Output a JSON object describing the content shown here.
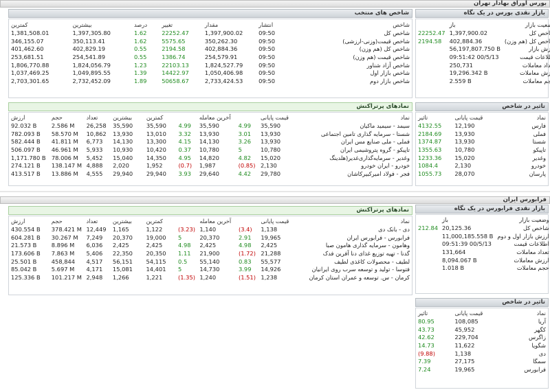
{
  "top_bar": {
    "title": "بورس اوراق بهادار تهران"
  },
  "tse_overview": {
    "title": "بازار نقدی بورس در یک نگاه",
    "rows": [
      {
        "label": "وضعیت بازار",
        "value": "باز",
        "change": ""
      },
      {
        "label": "شاخص کل",
        "value": "1,397,900.02",
        "change": "22252.47"
      },
      {
        "label": "شاخص کل (هم وزن)",
        "value": "402,884.36",
        "change": "2194.58"
      },
      {
        "label": "ارزش بازار",
        "value": "56,197,807.750 B",
        "change": ""
      },
      {
        "label": "اطلاعات قیمت",
        "value": "09:51:42 00/5/13",
        "change": ""
      },
      {
        "label": "تعداد معاملات",
        "value": "250,731",
        "change": ""
      },
      {
        "label": "ارزش معاملات",
        "value": "19,296.342 B",
        "change": ""
      },
      {
        "label": "حجم معاملات",
        "value": "2.559 B",
        "change": ""
      }
    ]
  },
  "selected_indices": {
    "title": "شاخص های منتخب",
    "columns": [
      "شاخص",
      "انتشار",
      "مقدار",
      "تغییر",
      "درصد",
      "بیشترین",
      "کمترین"
    ],
    "rows": [
      [
        "شاخص کل",
        "09:50",
        "1,397,900.02",
        "22252.47",
        "1.62",
        "1,397,305.80",
        "1,381,508.01"
      ],
      [
        "شاخص قیمت(وزنی-ارزشی)",
        "09:50",
        "350,262.30",
        "5575.65",
        "1.62",
        "350,113.41",
        "346,155.07"
      ],
      [
        "شاخص کل (هم وزن)",
        "09:50",
        "402,884.36",
        "2194.58",
        "0.55",
        "402,829.19",
        "401,462.60"
      ],
      [
        "شاخص قیمت (هم وزن)",
        "09:50",
        "254,579.91",
        "1386.74",
        "0.55",
        "254,541.89",
        "253,681.51"
      ],
      [
        "شاخص آزاد شناور",
        "09:50",
        "1,824,527.79",
        "22103.13",
        "1.23",
        "1,824,056.79",
        "1,806,770.88"
      ],
      [
        "شاخص بازار اول",
        "09:50",
        "1,050,406.98",
        "14422.97",
        "1.39",
        "1,049,895.55",
        "1,037,469.25"
      ],
      [
        "شاخص بازار دوم",
        "09:50",
        "2,733,424.53",
        "50658.67",
        "1.89",
        "2,732,452.09",
        "2,703,301.65"
      ]
    ]
  },
  "tse_influence": {
    "title": "تاثیر در شاخص",
    "columns": [
      "نماد",
      "قیمت پایانی",
      "تاثیر"
    ],
    "rows": [
      [
        "فارس",
        "12,190",
        "4132.55"
      ],
      [
        "فملی",
        "13,930",
        "2184.69"
      ],
      [
        "شستا",
        "13,930",
        "1374.87"
      ],
      [
        "تاپیکو",
        "10,780",
        "1355.63"
      ],
      [
        "وغدیر",
        "15,020",
        "1233.36"
      ],
      [
        "خودرو",
        "2,130",
        "1084.4"
      ],
      [
        "پارسان",
        "28,070",
        "1055.73"
      ]
    ]
  },
  "tse_top_symbols": {
    "title": "نمادهای پرتراکنش",
    "columns": [
      "نماد",
      "قیمت پایانی",
      "",
      "آخرین معامله",
      "",
      "کمترین",
      "بیشترین",
      "تعداد",
      "حجم",
      "ارزش"
    ],
    "rows": [
      [
        "سیمد - سیمید ماکیان",
        "35,590",
        "4.99",
        "35,590",
        "4.99",
        "35,590",
        "35,590",
        "26,258",
        "2.586 M",
        "92.032 B"
      ],
      [
        "شستا - سرمایه گذاری تامین اجتماعی",
        "13,930",
        "3.01",
        "13,930",
        "3.32",
        "13,010",
        "13,930",
        "10,862",
        "58.570 M",
        "782.093 B"
      ],
      [
        "فملی - ملی صنایع مس ایران",
        "13,930",
        "3.26",
        "14,130",
        "4.15",
        "13,300",
        "14,130",
        "6,773",
        "41.811 M",
        "582.444 B"
      ],
      [
        "تاپیکو - گروه پتروشیمی ایران",
        "10,780",
        "5",
        "10,780",
        "0.37",
        "10,420",
        "10,930",
        "5,933",
        "46.961 M",
        "506.097 B"
      ],
      [
        "وغدیر - سرمایه‌گذاری‌غدیر(هلدینگ",
        "15,020",
        "4.82",
        "14,820",
        "4.95",
        "14,350",
        "15,040",
        "5,452",
        "78.006 M",
        "1,171.780 B"
      ],
      [
        "خودرو - ایران خودرو",
        "2,130",
        "(0.85)",
        "1,987",
        "(0.7)",
        "1,952",
        "2,020",
        "4,888",
        "138.147 M",
        "274.121 B"
      ],
      [
        "فجر - فولاد امیرکبیرکاشان",
        "29,780",
        "4.42",
        "29,640",
        "3.93",
        "29,940",
        "29,940",
        "4,555",
        "13.886 M",
        "413.517 B"
      ]
    ]
  },
  "ifb_bar": {
    "title": "فرابورس ایران"
  },
  "ifb_overview": {
    "title": "بازار نقدی فرابورس در یک نگاه",
    "rows": [
      {
        "label": "وضعیت بازار",
        "value": "باز",
        "change": ""
      },
      {
        "label": "شاخص کل",
        "value": "20,125.36",
        "change": "212.84"
      },
      {
        "label": "ارزش بازار اول و دوم",
        "value": "11,000,185.558 B",
        "change": ""
      },
      {
        "label": "اطلاعات قیمت",
        "value": "09:51:39 00/5/13",
        "change": ""
      },
      {
        "label": "تعداد معاملات",
        "value": "131,664",
        "change": ""
      },
      {
        "label": "ارزش معاملات",
        "value": "8,094.067 B",
        "change": ""
      },
      {
        "label": "حجم معاملات",
        "value": "1.018 B",
        "change": ""
      }
    ]
  },
  "ifb_top_symbols": {
    "title": "نمادهای پرتراکنش",
    "columns": [
      "نماد",
      "قیمت پایانی",
      "",
      "آخرین معامله",
      "",
      "کمترین",
      "بیشترین",
      "تعداد",
      "حجم",
      "ارزش"
    ],
    "rows": [
      [
        "دی - بانک دی",
        "1,138",
        "(3.4)",
        "1,140",
        "(3.23)",
        "1,122",
        "1,165",
        "12,449",
        "378.421 M",
        "430.554 B"
      ],
      [
        "فرابورس - فرابورس ایران",
        "19,965",
        "2.91",
        "20,370",
        "5",
        "19,000",
        "20,370",
        "7,249",
        "30.267 M",
        "604.281 B"
      ],
      [
        "وهامون - سرمایه گذاری هامون صبا",
        "2,425",
        "4.98",
        "2,425",
        "4.98",
        "2,425",
        "2,425",
        "6,036",
        "8.896 M",
        "21.573 B"
      ],
      [
        "گدنا - تهیه توزیع غذای دنا آفرین فدک",
        "21,288",
        "(1.72)",
        "21,900",
        "1.11",
        "20,350",
        "22,350",
        "5,406",
        "7.863 M",
        "173.606 B"
      ],
      [
        "لطیف - محصولات کاغذی لطیف",
        "55,577",
        "0.83",
        "55,140",
        "0.5",
        "54,115",
        "56,151",
        "4,517",
        "458,844",
        "25.501 B"
      ],
      [
        "فتوسا - تولید و توسعه سرب روی ایرانیان",
        "14,926",
        "3.99",
        "14,730",
        "5",
        "14,401",
        "15,081",
        "4,171",
        "5.697 M",
        "85.042 B"
      ],
      [
        "کرمان - س. توسعه و عمران استان کرمان",
        "1,238",
        "(1.51)",
        "1,240",
        "(1.35)",
        "1,221",
        "1,266",
        "2,948",
        "101.217 M",
        "125.336 B"
      ]
    ]
  },
  "ifb_influence": {
    "title": "تاثیر در شاخص",
    "columns": [
      "نماد",
      "قیمت پایانی",
      "تاثیر"
    ],
    "rows": [
      [
        "آریا",
        "108,085",
        "80.95"
      ],
      [
        "کگهر",
        "45,952",
        "43.73"
      ],
      [
        "زاگرس",
        "229,704",
        "42.62"
      ],
      [
        "شگویا",
        "11,622",
        "14.73"
      ],
      [
        "دی",
        "1,138",
        "(9.88)"
      ],
      [
        "سمگا",
        "27,175",
        "7.39"
      ],
      [
        "فرابورس",
        "19,965",
        "7.24"
      ]
    ]
  },
  "colors": {
    "positive": "#1e8a1e",
    "negative": "#c00000",
    "header_green": "#e8f5e4",
    "header_grey": "#dde1e5"
  }
}
